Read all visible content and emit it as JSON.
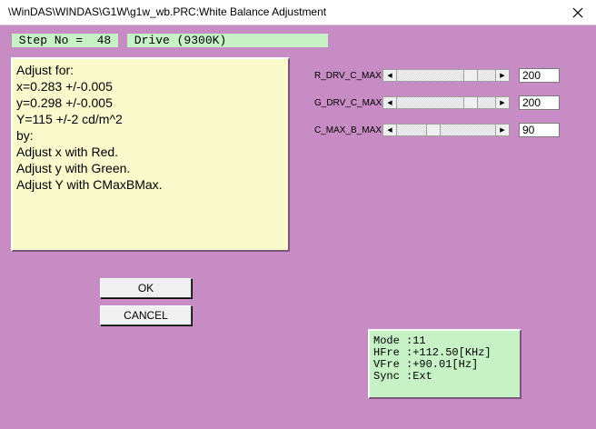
{
  "window": {
    "title": "\\WinDAS\\WINDAS\\G1W\\g1w_wb.PRC:White Balance Adjustment",
    "close_icon": "close-icon"
  },
  "step": {
    "label": " Step No =  48",
    "drive": " Drive (9300K)"
  },
  "instructions": {
    "lines": [
      "Adjust for:",
      "x=0.283 +/-0.005",
      "y=0.298 +/-0.005",
      "Y=115 +/-2 cd/m^2",
      "by:",
      "Adjust x with Red.",
      "Adjust y with Green.",
      "Adjust Y with CMaxBMax."
    ]
  },
  "sliders": [
    {
      "label": "R_DRV_C_MAX",
      "value": "200",
      "level": 0.785
    },
    {
      "label": "G_DRV_C_MAX",
      "value": "200",
      "level": 0.785
    },
    {
      "label": "C_MAX_B_MAX",
      "value": "90",
      "level": 0.353
    }
  ],
  "buttons": {
    "ok": "OK",
    "cancel": "CANCEL"
  },
  "status": {
    "mode": "Mode :11",
    "hfre": "HFre :+112.50[KHz]",
    "vfre": "VFre :+90.01[Hz]",
    "sync": "Sync :Ext"
  },
  "colors": {
    "client_bg": "#c78cc3",
    "step_bg": "#c6f2c6",
    "instructions_bg": "#fafacc",
    "status_bg": "#c6f2c6"
  }
}
